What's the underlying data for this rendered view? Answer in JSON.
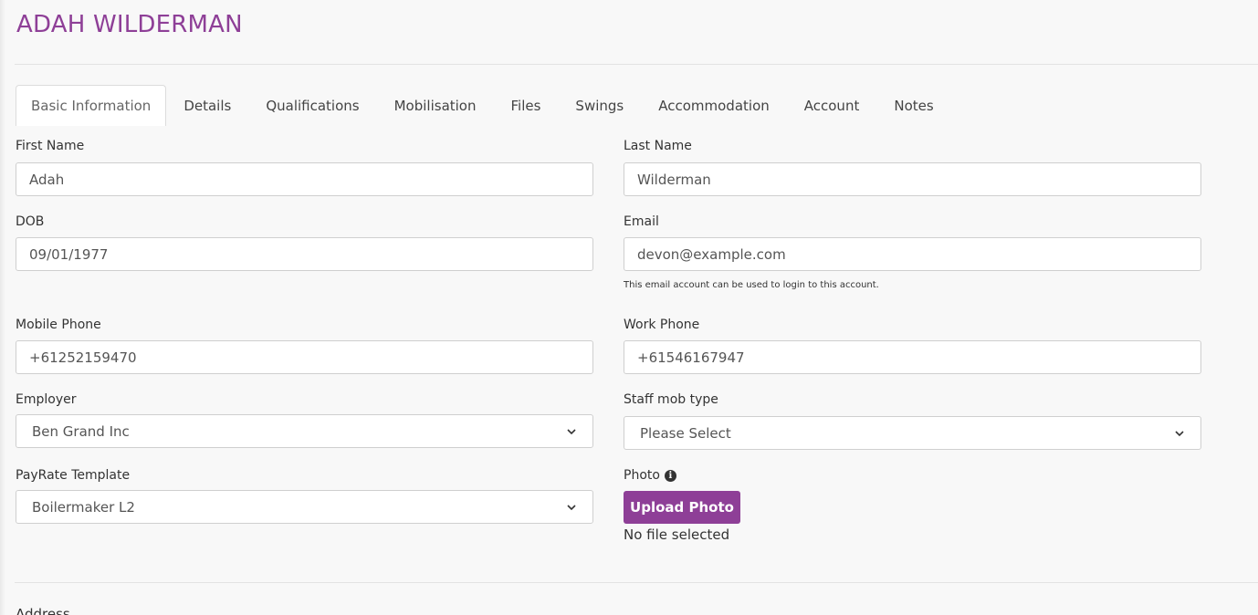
{
  "header": {
    "title": "ADAH WILDERMAN"
  },
  "tabs": [
    {
      "label": "Basic Information",
      "active": true
    },
    {
      "label": "Details"
    },
    {
      "label": "Qualifications"
    },
    {
      "label": "Mobilisation"
    },
    {
      "label": "Files"
    },
    {
      "label": "Swings"
    },
    {
      "label": "Accommodation"
    },
    {
      "label": "Account"
    },
    {
      "label": "Notes"
    }
  ],
  "form": {
    "first_name": {
      "label": "First Name",
      "value": "Adah"
    },
    "last_name": {
      "label": "Last Name",
      "value": "Wilderman"
    },
    "dob": {
      "label": "DOB",
      "value": "09/01/1977"
    },
    "email": {
      "label": "Email",
      "value": "devon@example.com",
      "help": "This email account can be used to login to this account."
    },
    "mobile_phone": {
      "label": "Mobile Phone",
      "value": "+61252159470"
    },
    "work_phone": {
      "label": "Work Phone",
      "value": "+61546167947"
    },
    "employer": {
      "label": "Employer",
      "value": "Ben Grand Inc"
    },
    "staff_mob_type": {
      "label": "Staff mob type",
      "value": "Please Select"
    },
    "payrate_template": {
      "label": "PayRate Template",
      "value": "Boilermaker L2"
    },
    "photo": {
      "label": "Photo",
      "button": "Upload Photo",
      "status": "No file selected"
    }
  },
  "next_section": {
    "label": "Address"
  },
  "colors": {
    "brand": "#8e3f97"
  },
  "icons": {
    "info": "info-circle-icon",
    "select": "chevron-down-icon"
  }
}
